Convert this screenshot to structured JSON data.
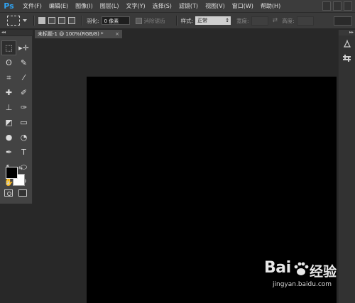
{
  "app": {
    "logo": "Ps"
  },
  "menu": [
    "文件(F)",
    "编辑(E)",
    "图像(I)",
    "图层(L)",
    "文字(Y)",
    "选择(S)",
    "滤镜(T)",
    "视图(V)",
    "窗口(W)",
    "帮助(H)"
  ],
  "options": {
    "feather_label": "羽化:",
    "feather_value": "0 像素",
    "antialias_label": "消除锯齿",
    "style_label": "样式:",
    "style_value": "正常",
    "width_label": "宽度:",
    "height_label": "高度:"
  },
  "toolbar": {
    "collapse": "◂◂"
  },
  "tools": [
    {
      "name": "marquee-tool-icon",
      "glyph": "⬚"
    },
    {
      "name": "move-tool-icon",
      "glyph": "▸✛"
    },
    {
      "name": "lasso-tool-icon",
      "glyph": "ʘ"
    },
    {
      "name": "quick-selection-tool-icon",
      "glyph": "✎"
    },
    {
      "name": "crop-tool-icon",
      "glyph": "⌗"
    },
    {
      "name": "eyedropper-tool-icon",
      "glyph": "⁄"
    },
    {
      "name": "healing-brush-tool-icon",
      "glyph": "✚"
    },
    {
      "name": "brush-tool-icon",
      "glyph": "✐"
    },
    {
      "name": "clone-stamp-tool-icon",
      "glyph": "⊥"
    },
    {
      "name": "history-brush-tool-icon",
      "glyph": "✑"
    },
    {
      "name": "eraser-tool-icon",
      "glyph": "◩"
    },
    {
      "name": "gradient-tool-icon",
      "glyph": "▭"
    },
    {
      "name": "blur-tool-icon",
      "glyph": "●"
    },
    {
      "name": "dodge-tool-icon",
      "glyph": "◔"
    },
    {
      "name": "pen-tool-icon",
      "glyph": "✒"
    },
    {
      "name": "type-tool-icon",
      "glyph": "T"
    },
    {
      "name": "path-selection-tool-icon",
      "glyph": "↖"
    },
    {
      "name": "shape-tool-icon",
      "glyph": "⬭"
    },
    {
      "name": "hand-tool-icon",
      "glyph": "✋"
    },
    {
      "name": "zoom-tool-icon",
      "glyph": "⚲"
    }
  ],
  "colors": {
    "foreground": "#000000",
    "background": "#ffffff",
    "app_accent": "#2fa3f2"
  },
  "document": {
    "tab_title": "未标题-1 @ 100%(RGB/8) *",
    "close": "×"
  },
  "right_panel": {
    "collapse": "▸▸"
  },
  "watermark": {
    "logo": "Bai",
    "logo_cn": "经验",
    "url": "jingyan.baidu.com"
  }
}
